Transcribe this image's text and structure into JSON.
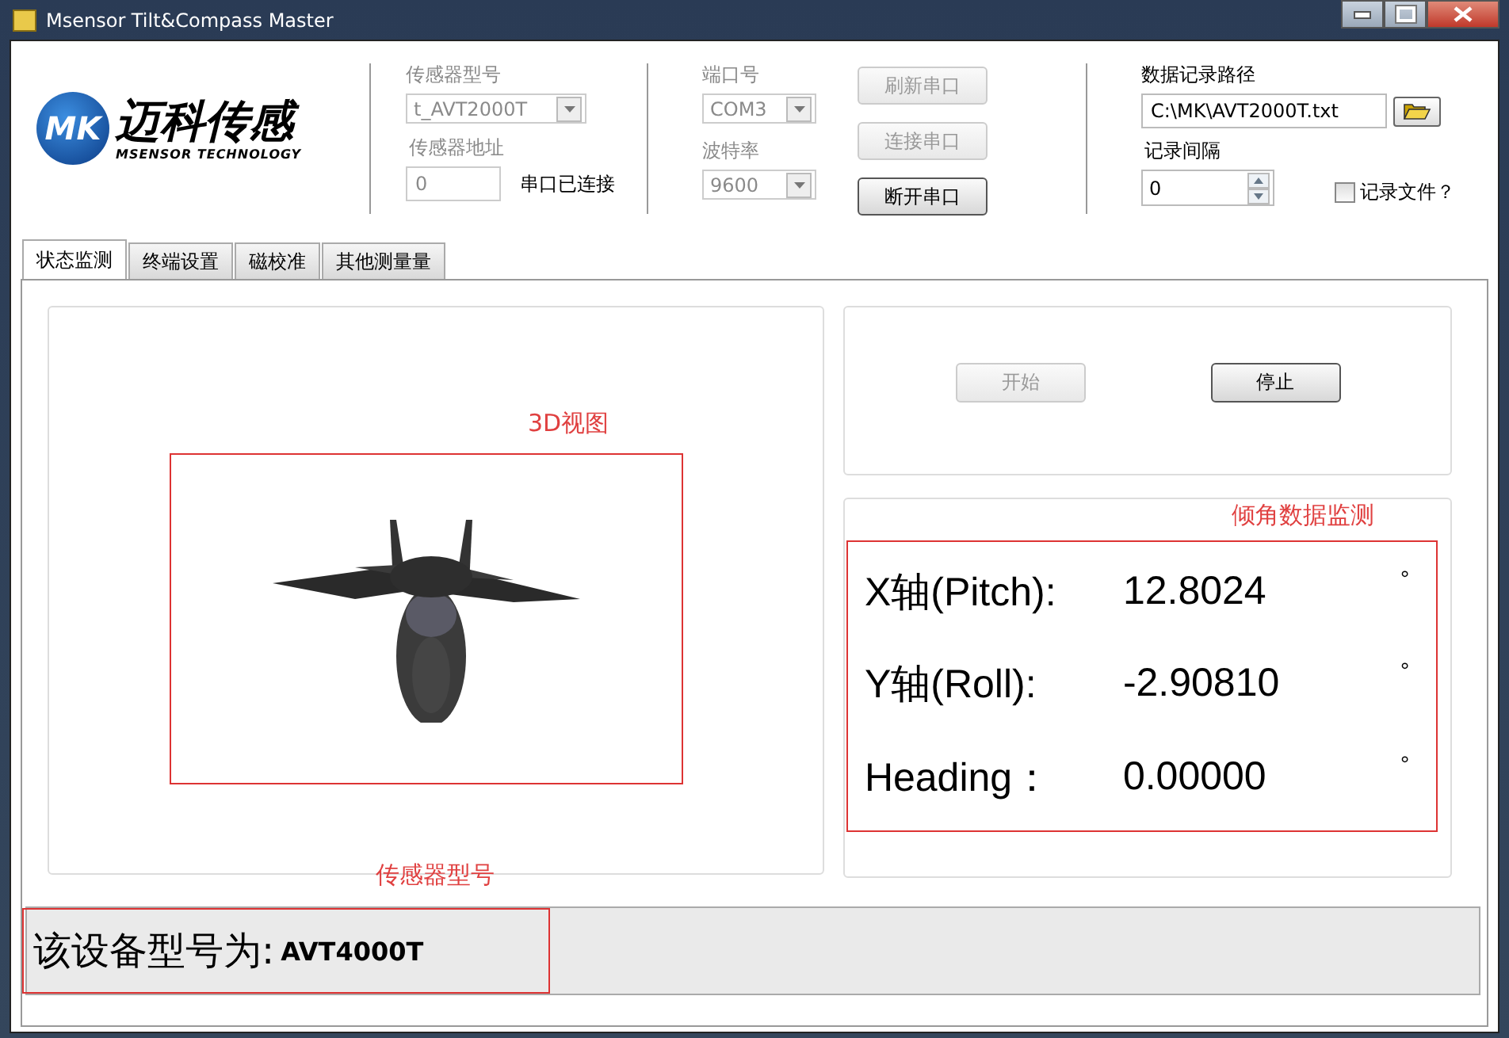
{
  "window": {
    "title": "Msensor Tilt&Compass Master"
  },
  "logo": {
    "badge": "MK",
    "name": "迈科传感",
    "tagline": "MSENSOR TECHNOLOGY"
  },
  "sensor": {
    "model_label": "传感器型号",
    "model_value": "t_AVT2000T",
    "address_label": "传感器地址",
    "address_value": "0",
    "status": "串口已连接"
  },
  "port": {
    "port_label": "端口号",
    "port_value": "COM3",
    "baud_label": "波特率",
    "baud_value": "9600"
  },
  "port_buttons": [
    {
      "label": "刷新串口",
      "disabled": true
    },
    {
      "label": "连接串口",
      "disabled": true
    },
    {
      "label": "断开串口",
      "disabled": false
    }
  ],
  "logging": {
    "path_label": "数据记录路径",
    "path_value": "C:\\MK\\AVT2000T.txt",
    "interval_label": "记录间隔",
    "interval_value": "0",
    "record_file": {
      "label": "记录文件？",
      "checked": false
    }
  },
  "tabs": [
    {
      "label": "状态监测",
      "selected": true
    },
    {
      "label": "终端设置",
      "selected": false
    },
    {
      "label": "磁校准",
      "selected": false
    },
    {
      "label": "其他测量量",
      "selected": false
    }
  ],
  "view_annotation": "3D视图",
  "controls": [
    {
      "label": "开始",
      "disabled": true
    },
    {
      "label": "停止",
      "disabled": false
    }
  ],
  "readings_annotation": "倾角数据监测",
  "readings": [
    {
      "label": "X轴(Pitch):",
      "value": "12.8024",
      "unit": "°"
    },
    {
      "label": "Y轴(Roll):",
      "value": "-2.90810",
      "unit": "°"
    },
    {
      "label": "Heading：",
      "value": "0.00000",
      "unit": "°"
    }
  ],
  "model_annotation": "传感器型号",
  "device_model": {
    "label": "该设备型号为:",
    "value": "AVT4000T"
  }
}
